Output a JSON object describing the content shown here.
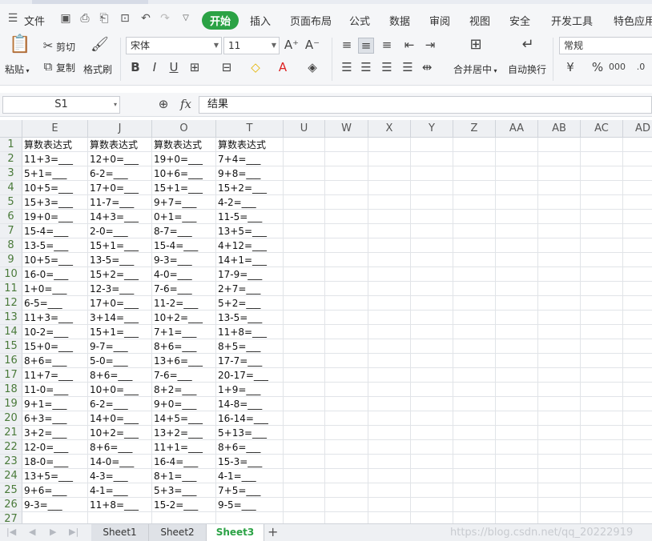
{
  "menubar": {
    "file_label": "文件",
    "tabs": [
      "开始",
      "插入",
      "页面布局",
      "公式",
      "数据",
      "审阅",
      "视图",
      "安全",
      "开发工具",
      "特色应用"
    ]
  },
  "ribbon": {
    "paste": "粘贴",
    "cut": "剪切",
    "copy": "复制",
    "format_painter": "格式刷",
    "font_name": "宋体",
    "font_size": "11",
    "merge_center": "合并居中",
    "wrap_text": "自动换行",
    "number_format": "常规"
  },
  "formula_bar": {
    "name_box": "S1",
    "content": "结果"
  },
  "grid": {
    "columns": [
      "E",
      "J",
      "O",
      "T",
      "U",
      "W",
      "X",
      "Y",
      "Z",
      "AA",
      "AB",
      "AC",
      "AD"
    ],
    "rows": [
      "1",
      "2",
      "3",
      "4",
      "5",
      "6",
      "7",
      "8",
      "9",
      "10",
      "11",
      "12",
      "13",
      "14",
      "15",
      "16",
      "17",
      "18",
      "19",
      "20",
      "21",
      "22",
      "23",
      "24",
      "25",
      "26",
      "27"
    ],
    "cells": [
      [
        "算数表达式",
        "算数表达式",
        "算数表达式",
        "算数表达式"
      ],
      [
        "11+3=___",
        "12+0=___",
        "19+0=___",
        "7+4=___"
      ],
      [
        "5+1=___",
        "6-2=___",
        "10+6=___",
        "9+8=___"
      ],
      [
        "10+5=___",
        "17+0=___",
        "15+1=___",
        "15+2=___"
      ],
      [
        "15+3=___",
        "11-7=___",
        "9+7=___",
        "4-2=___"
      ],
      [
        "19+0=___",
        "14+3=___",
        "0+1=___",
        "11-5=___"
      ],
      [
        "15-4=___",
        "2-0=___",
        "8-7=___",
        "13+5=___"
      ],
      [
        "13-5=___",
        "15+1=___",
        "15-4=___",
        "4+12=___"
      ],
      [
        "10+5=___",
        "13-5=___",
        "9-3=___",
        "14+1=___"
      ],
      [
        "16-0=___",
        "15+2=___",
        "4-0=___",
        "17-9=___"
      ],
      [
        "1+0=___",
        "12-3=___",
        "7-6=___",
        "2+7=___"
      ],
      [
        "6-5=___",
        "17+0=___",
        "11-2=___",
        "5+2=___"
      ],
      [
        "11+3=___",
        "3+14=___",
        "10+2=___",
        "13-5=___"
      ],
      [
        "10-2=___",
        "15+1=___",
        "7+1=___",
        "11+8=___"
      ],
      [
        "15+0=___",
        "9-7=___",
        "8+6=___",
        "8+5=___"
      ],
      [
        "8+6=___",
        "5-0=___",
        "13+6=___",
        "17-7=___"
      ],
      [
        "11+7=___",
        "8+6=___",
        "7-6=___",
        "20-17=___"
      ],
      [
        "11-0=___",
        "10+0=___",
        "8+2=___",
        "1+9=___"
      ],
      [
        "9+1=___",
        "6-2=___",
        "9+0=___",
        "14-8=___"
      ],
      [
        "6+3=___",
        "14+0=___",
        "14+5=___",
        "16-14=___"
      ],
      [
        "3+2=___",
        "10+2=___",
        "13+2=___",
        "5+13=___"
      ],
      [
        "12-0=___",
        "8+6=___",
        "11+1=___",
        "8+6=___"
      ],
      [
        "18-0=___",
        "14-0=___",
        "16-4=___",
        "15-3=___"
      ],
      [
        "13+5=___",
        "4-3=___",
        "8+1=___",
        "4-1=___"
      ],
      [
        "9+6=___",
        "4-1=___",
        "5+3=___",
        "7+5=___"
      ],
      [
        "9-3=___",
        "11+8=___",
        "15-2=___",
        "9-5=___"
      ],
      [
        "",
        "",
        "",
        ""
      ]
    ]
  },
  "sheets": {
    "tabs": [
      "Sheet1",
      "Sheet2",
      "Sheet3"
    ],
    "active": "Sheet3",
    "add": "+"
  },
  "watermark": "https://blog.csdn.net/qq_20222919"
}
